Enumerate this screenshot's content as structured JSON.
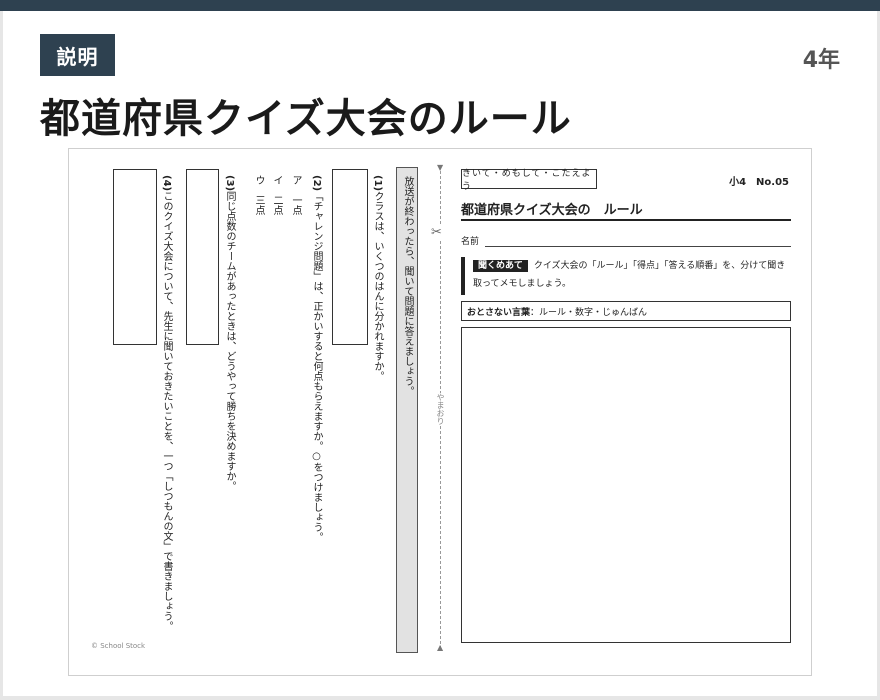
{
  "header": {
    "badge": "説明",
    "grade": "4年",
    "title": "都道府県クイズ大会のルール"
  },
  "worksheet": {
    "instruction": "放送が終わったら、聞いて問題に答えましょう。",
    "questions": [
      {
        "number": "(1)",
        "text": "クラスは、いくつのはんに分かれますか。"
      },
      {
        "number": "(2)",
        "text": "「チャレンジ問題」は、正かいすると何点もらえますか。○をつけましょう。"
      },
      {
        "number": "(3)",
        "text": "同じ点数のチームがあったときは、どうやって勝ちを決めますか。"
      },
      {
        "number": "(4)",
        "text": "このクイズ大会について、先生に聞いておきたいことを、一つ「しつもんの文」で書きましょう。"
      }
    ],
    "options": [
      "ア　一点",
      "イ　二点",
      "ウ　三点"
    ],
    "fold_label": "やまおり",
    "sub_tag": "きいて・めもして・こたえよう",
    "sheet_no": "小4　No.05",
    "sheet_title": "都道府県クイズ大会の　ルール",
    "name_label": "名前",
    "listen_tag": "聞くめあて",
    "listen_text": "クイズ大会の「ルール」「得点」「答える順番」を、分けて聞き取ってメモしましょう。",
    "keywords_label": "おとさない言葉",
    "keywords_text": "：ルール・数字・じゅんばん",
    "copyright": "© School Stock"
  }
}
